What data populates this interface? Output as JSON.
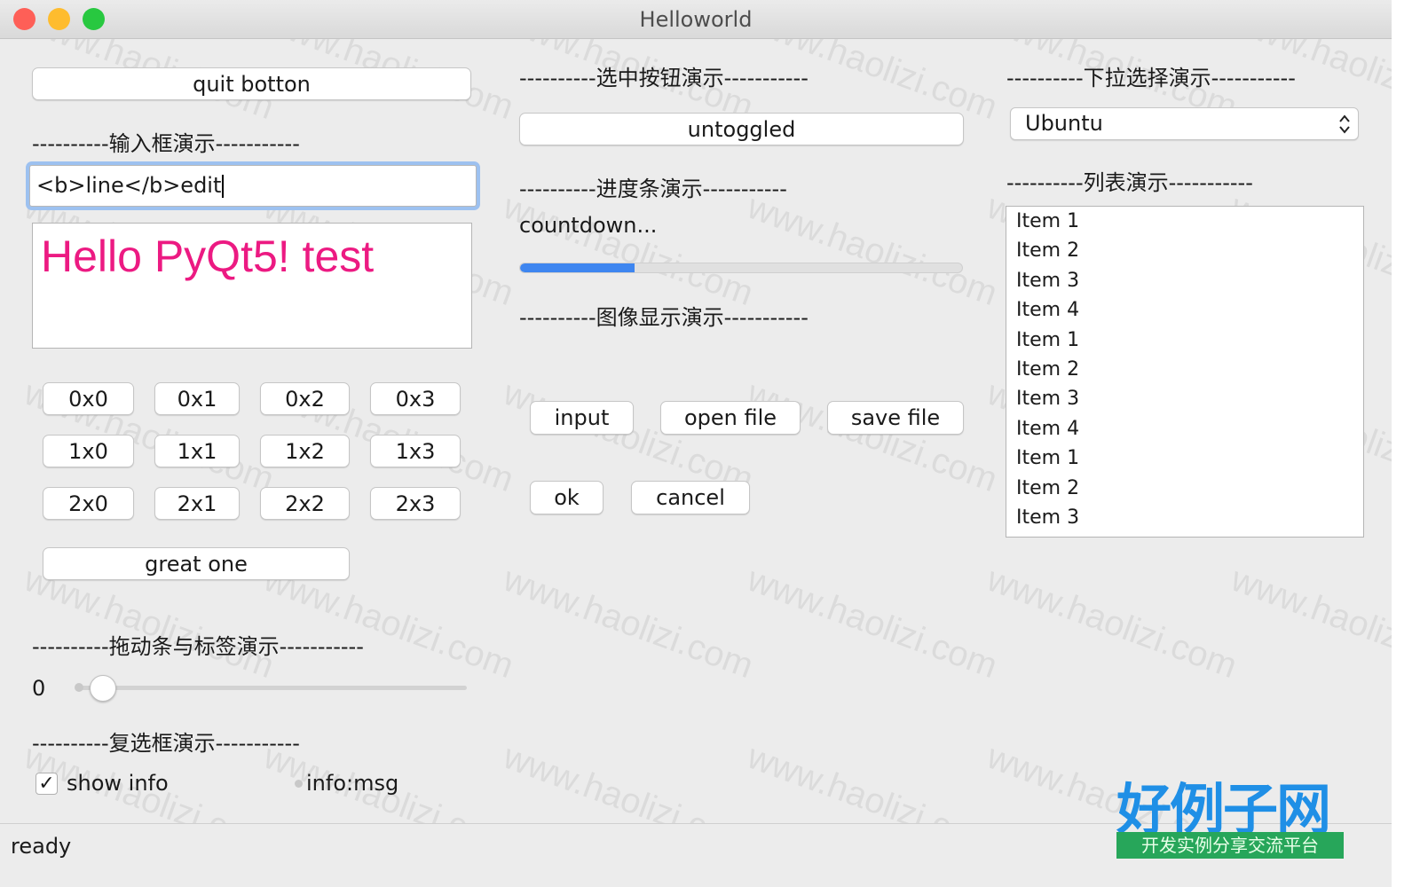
{
  "window": {
    "title": "Helloworld"
  },
  "left": {
    "quit_button": "quit botton",
    "input_section": "----------输入框演示-----------",
    "line_edit_value": "<b>line</b>edit",
    "text_edit": {
      "content": "Hello PyQt5! test",
      "color": "#ec1a82"
    },
    "grid_buttons": [
      [
        "0x0",
        "0x1",
        "0x2",
        "0x3"
      ],
      [
        "1x0",
        "1x1",
        "1x2",
        "1x3"
      ],
      [
        "2x0",
        "2x1",
        "2x2",
        "2x3"
      ]
    ],
    "great_button": "great one",
    "slider_section": "----------拖动条与标签演示-----------",
    "slider_value": "0",
    "checkbox_section": "----------复选框演示-----------",
    "checkbox": {
      "label": "show info",
      "checked": true,
      "mark": "✓"
    },
    "info_label": "info:msg"
  },
  "middle": {
    "toggle_section": "----------选中按钮演示-----------",
    "toggle_button": "untoggled",
    "progress_section": "----------进度条演示-----------",
    "countdown_label": "countdown...",
    "progress": {
      "value_percent": 26,
      "color": "#3e86f0"
    },
    "image_section": "----------图像显示演示-----------",
    "input_button": "input",
    "open_button": "open file",
    "save_button": "save file",
    "ok_button": "ok",
    "cancel_button": "cancel"
  },
  "right": {
    "combo_section": "----------下拉选择演示-----------",
    "combo_value": "Ubuntu",
    "list_section": "----------列表演示-----------",
    "list_items": [
      "Item 1",
      "Item 2",
      "Item 3",
      "Item 4",
      "Item 1",
      "Item 2",
      "Item 3",
      "Item 4",
      "Item 1",
      "Item 2",
      "Item 3"
    ]
  },
  "status": {
    "text": "ready"
  },
  "watermark": {
    "text": "www.haolizi.com",
    "logo_title": "好例子网",
    "logo_subtitle": "开发实例分享交流平台"
  },
  "colors": {
    "close": "#fe5f57",
    "minimize": "#febc2e",
    "zoom": "#28c840",
    "focus_ring": "#9dc1f0"
  }
}
